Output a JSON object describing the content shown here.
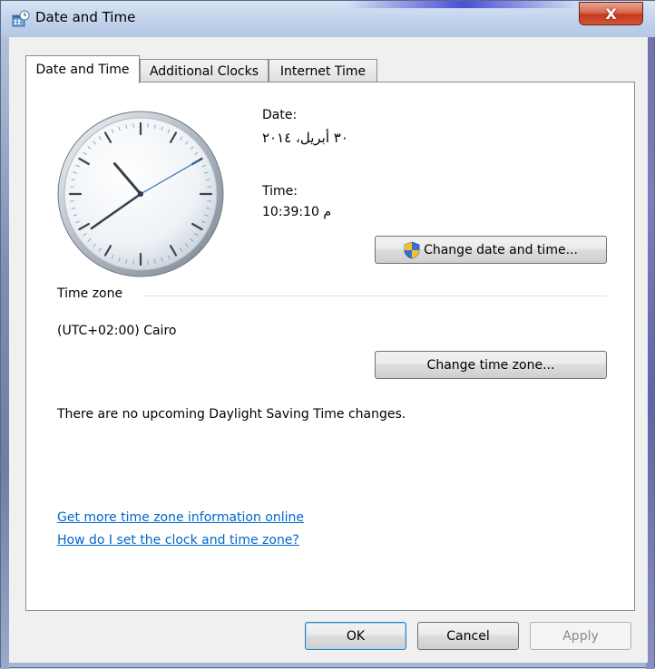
{
  "window": {
    "title": "Date and Time",
    "close_label": "X"
  },
  "tabs": [
    {
      "label": "Date and Time",
      "active": true
    },
    {
      "label": "Additional Clocks",
      "active": false
    },
    {
      "label": "Internet Time",
      "active": false
    }
  ],
  "clock": {
    "time": "10:39:10"
  },
  "date_section": {
    "date_label": "Date:",
    "date_value": "٣٠ أبريل، ٢٠١٤",
    "time_label": "Time:",
    "time_value": "10:39:10 م",
    "change_button": "Change date and time..."
  },
  "timezone": {
    "group_label": "Time zone",
    "current": "(UTC+02:00) Cairo",
    "change_button": "Change time zone...",
    "dst_message": "There are no upcoming Daylight Saving Time changes."
  },
  "links": {
    "more_info": "Get more time zone information online",
    "help": "How do I set the clock and time zone?"
  },
  "footer": {
    "ok": "OK",
    "cancel": "Cancel",
    "apply": "Apply"
  },
  "colors": {
    "link": "#0066cc",
    "close_button": "#c4391c"
  }
}
